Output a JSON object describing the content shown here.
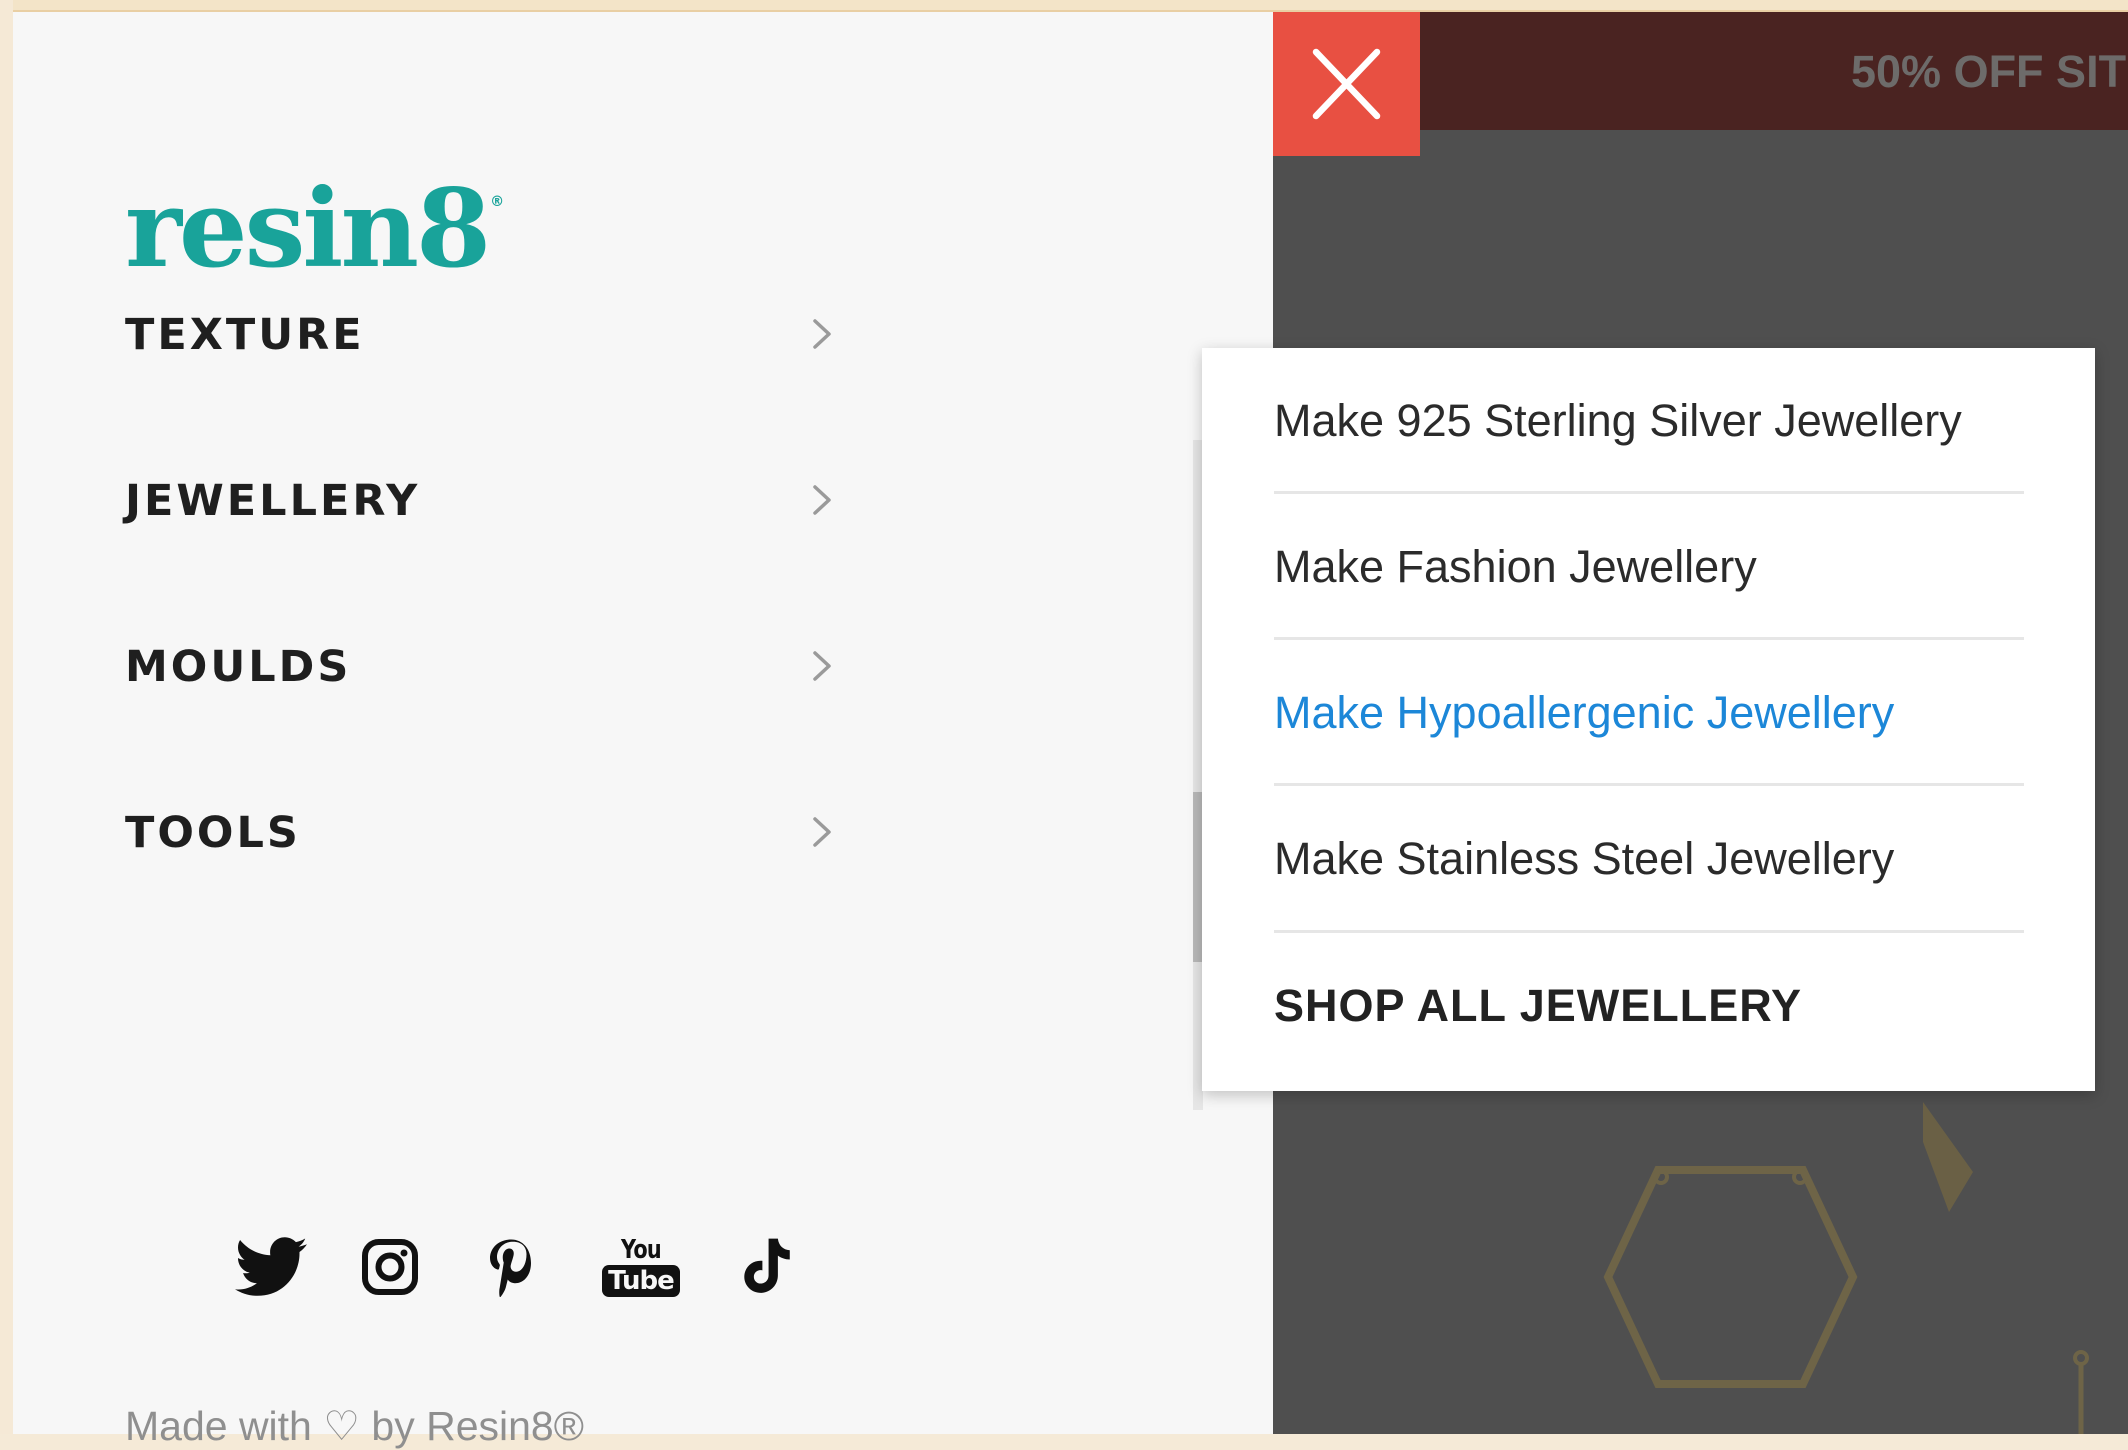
{
  "brand": {
    "name": "resin8",
    "registered_mark": "®",
    "logo_color": "#19a39a"
  },
  "menu": {
    "items": [
      {
        "label": "TEXTURE",
        "icon": "chevron-right-icon"
      },
      {
        "label": "JEWELLERY",
        "icon": "chevron-right-icon"
      },
      {
        "label": "MOULDS",
        "icon": "chevron-right-icon"
      },
      {
        "label": "TOOLS",
        "icon": "chevron-right-icon"
      }
    ]
  },
  "social": {
    "icons": [
      "twitter-icon",
      "instagram-icon",
      "pinterest-icon",
      "youtube-icon",
      "tiktok-icon"
    ],
    "youtube_top": "You",
    "youtube_bottom": "Tube"
  },
  "footer": {
    "text": "Made with ♡ by Resin8®"
  },
  "promo": {
    "text": "50% OFF SIT",
    "background": "#4a2321"
  },
  "close_button": {
    "icon": "close-icon",
    "color": "#e85042"
  },
  "submenu": {
    "items": [
      {
        "label": "Make 925 Sterling Silver Jewellery"
      },
      {
        "label": "Make Fashion Jewellery"
      },
      {
        "label": "Make Hypoallergenic Jewellery",
        "active": true
      },
      {
        "label": "Make Stainless Steel Jewellery"
      },
      {
        "label": "SHOP ALL JEWELLERY"
      }
    ],
    "active_color": "#1c87d8"
  }
}
